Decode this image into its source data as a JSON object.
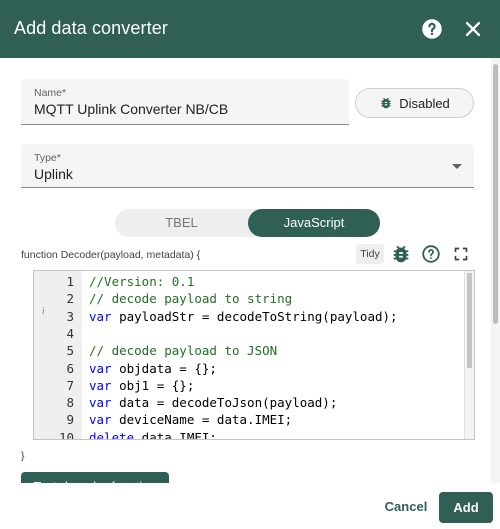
{
  "dialog": {
    "title": "Add data converter"
  },
  "icons": {
    "help": "help-circle-icon",
    "close": "close-icon",
    "bug": "bug-icon",
    "fullscreen": "fullscreen-icon"
  },
  "name_field": {
    "label": "Name*",
    "value": "MQTT Uplink Converter NB/CB"
  },
  "debug_button": {
    "label": "Disabled"
  },
  "type_field": {
    "label": "Type*",
    "value": "Uplink"
  },
  "toggle": {
    "options": [
      "TBEL",
      "JavaScript"
    ],
    "selected": "JavaScript"
  },
  "editor": {
    "signature": "function Decoder(payload, metadata) {",
    "tidy_label": "Tidy",
    "closing": "}",
    "lines": [
      {
        "n": "1",
        "parts": [
          [
            "c",
            "//Version: 0.1"
          ]
        ]
      },
      {
        "n": "2",
        "parts": [
          [
            "c",
            "// decode payload to string"
          ]
        ]
      },
      {
        "n": "3",
        "parts": [
          [
            "k",
            "var"
          ],
          [
            "t",
            " payloadStr = decodeToString(payload);"
          ]
        ]
      },
      {
        "n": "4",
        "parts": []
      },
      {
        "n": "5",
        "parts": [
          [
            "c",
            "// decode payload to JSON"
          ]
        ]
      },
      {
        "n": "6",
        "parts": [
          [
            "k",
            "var"
          ],
          [
            "t",
            " objdata = {};"
          ]
        ]
      },
      {
        "n": "7",
        "parts": [
          [
            "k",
            "var"
          ],
          [
            "t",
            " obj1 = {};"
          ]
        ]
      },
      {
        "n": "8",
        "parts": [
          [
            "k",
            "var"
          ],
          [
            "t",
            " data = decodeToJson(payload);"
          ]
        ]
      },
      {
        "n": "9",
        "parts": [
          [
            "k",
            "var"
          ],
          [
            "t",
            " deviceName = data.IMEI;"
          ]
        ]
      },
      {
        "n": "10",
        "parts": [
          [
            "k",
            "delete"
          ],
          [
            "t",
            " data.IMEI;"
          ]
        ]
      }
    ]
  },
  "test_button": {
    "label": "Test decoder function"
  },
  "footer": {
    "cancel_label": "Cancel",
    "add_label": "Add"
  },
  "colors": {
    "primary": "#305f56",
    "comment": "#236e25",
    "keyword": "#0000ff"
  }
}
